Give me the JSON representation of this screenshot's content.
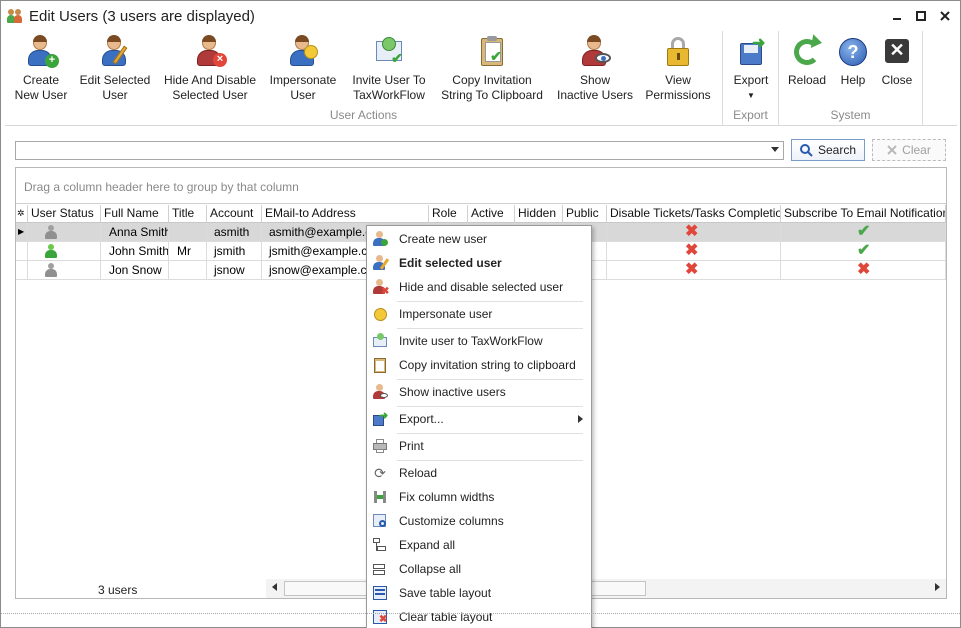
{
  "window": {
    "title": "Edit Users (3 users are displayed)",
    "controls": [
      "minimize-icon",
      "maximize-icon",
      "close-icon"
    ]
  },
  "ribbon": {
    "groups": [
      {
        "label": "User Actions",
        "buttons": [
          {
            "line1": "Create",
            "line2": "New User",
            "icon": "user-add-icon"
          },
          {
            "line1": "Edit Selected",
            "line2": "User",
            "icon": "user-edit-icon"
          },
          {
            "line1": "Hide And Disable",
            "line2": "Selected User",
            "icon": "user-hide-icon"
          },
          {
            "line1": "Impersonate",
            "line2": "User",
            "icon": "impersonate-icon"
          },
          {
            "line1": "Invite User To",
            "line2": "TaxWorkFlow",
            "icon": "invite-icon"
          },
          {
            "line1": "Copy Invitation",
            "line2": "String To Clipboard",
            "icon": "clipboard-icon"
          },
          {
            "line1": "Show",
            "line2": "Inactive Users",
            "icon": "inactive-users-icon"
          },
          {
            "line1": "View",
            "line2": "Permissions",
            "icon": "lock-icon"
          }
        ]
      },
      {
        "label": "Export",
        "buttons": [
          {
            "line1": "Export",
            "line2": "▼",
            "icon": "export-icon"
          }
        ]
      },
      {
        "label": "System",
        "buttons": [
          {
            "line1": "Reload",
            "line2": "",
            "icon": "reload-icon"
          },
          {
            "line1": "Help",
            "line2": "",
            "icon": "help-icon"
          },
          {
            "line1": "Close",
            "line2": "",
            "icon": "close-icon"
          }
        ]
      }
    ]
  },
  "search": {
    "value": "",
    "search_label": "Search",
    "clear_label": "Clear"
  },
  "grid": {
    "group_hint": "Drag a column header here to group by that column",
    "columns": [
      "User Status",
      "Full Name",
      "Title",
      "Account",
      "EMail-to Address",
      "Role",
      "Active",
      "Hidden",
      "Public",
      "Disable Tickets/Tasks Completion",
      "Subscribe To Email Notifications"
    ],
    "rows": [
      {
        "status": "inactive",
        "full_name": "Anna Smith",
        "title": "",
        "account": "asmith",
        "email": "asmith@example.com",
        "disable_tickets": false,
        "subscribe": true
      },
      {
        "status": "active",
        "full_name": "John Smith",
        "title": "Mr",
        "account": "jsmith",
        "email": "jsmith@example.com",
        "disable_tickets": false,
        "subscribe": true
      },
      {
        "status": "inactive",
        "full_name": "Jon Snow",
        "title": "",
        "account": "jsnow",
        "email": "jsnow@example.com",
        "disable_tickets": false,
        "subscribe": false
      }
    ],
    "footer_count": "3 users"
  },
  "context_menu": {
    "items": [
      {
        "label": "Create new user",
        "icon": "user-add-icon"
      },
      {
        "label": "Edit selected user",
        "icon": "user-edit-icon",
        "bold": true
      },
      {
        "label": "Hide and disable selected user",
        "icon": "user-hide-icon"
      },
      {
        "label": "Impersonate user",
        "icon": "impersonate-icon"
      },
      {
        "label": "Invite user to TaxWorkFlow",
        "icon": "invite-icon"
      },
      {
        "label": "Copy invitation string to clipboard",
        "icon": "clipboard-icon"
      },
      {
        "label": "Show inactive users",
        "icon": "inactive-users-icon"
      },
      {
        "label": "Export...",
        "icon": "export-icon",
        "submenu": true
      },
      {
        "label": "Print",
        "icon": "print-icon"
      },
      {
        "label": "Reload",
        "icon": "reload-icon"
      },
      {
        "label": "Fix column widths",
        "icon": "fix-columns-icon"
      },
      {
        "label": "Customize columns",
        "icon": "customize-columns-icon"
      },
      {
        "label": "Expand all",
        "icon": "expand-all-icon"
      },
      {
        "label": "Collapse all",
        "icon": "collapse-all-icon"
      },
      {
        "label": "Save table layout",
        "icon": "save-layout-icon"
      },
      {
        "label": "Clear table layout",
        "icon": "clear-layout-icon"
      }
    ]
  },
  "colors": {
    "accent": "#3a6fc2",
    "check": "#4aa84a",
    "cross": "#e0463a",
    "selected_row": "#d8d8d8"
  }
}
